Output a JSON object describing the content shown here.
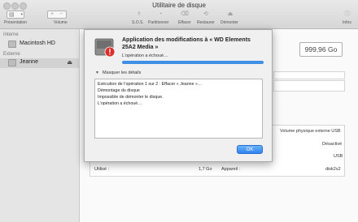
{
  "window": {
    "title": "Utilitaire de disque"
  },
  "toolbar": {
    "presentation": "Présentation",
    "volume": "Volume",
    "sos": "S.O.S.",
    "partition": "Partitionner",
    "erase": "Effacer",
    "restore": "Restaurer",
    "unmount": "Démonter",
    "info": "Infos"
  },
  "sidebar": {
    "internal_header": "Interne",
    "internal_items": [
      {
        "label": "Macintosh HD"
      }
    ],
    "external_header": "Externe",
    "external_items": [
      {
        "label": "Jeanne",
        "selected": true
      }
    ]
  },
  "main": {
    "capacity": "999,96 Go",
    "info_right": [
      "Volume physique externe USB",
      "Désactivé",
      "USB"
    ],
    "used_label": "Utilisé :",
    "used_value": "1,7 Go",
    "device_label": "Appareil :",
    "device_value": "disk2s2"
  },
  "dialog": {
    "title": "Application des modifications à « WD Elements 25A2 Media »",
    "status": "L’opération a échoué…",
    "progress": 1.0,
    "details_toggle": "Masquer les détails",
    "log": [
      "Exécution de l’opération 1 sur 2 : Effacer « Jeanne »…",
      "Démontage du disque",
      "Impossible de démonter le disque.",
      "L’opération a échoué…"
    ],
    "ok_label": "OK"
  },
  "colors": {
    "accent": "#3f8ee6",
    "error_badge": "#d9302b"
  }
}
